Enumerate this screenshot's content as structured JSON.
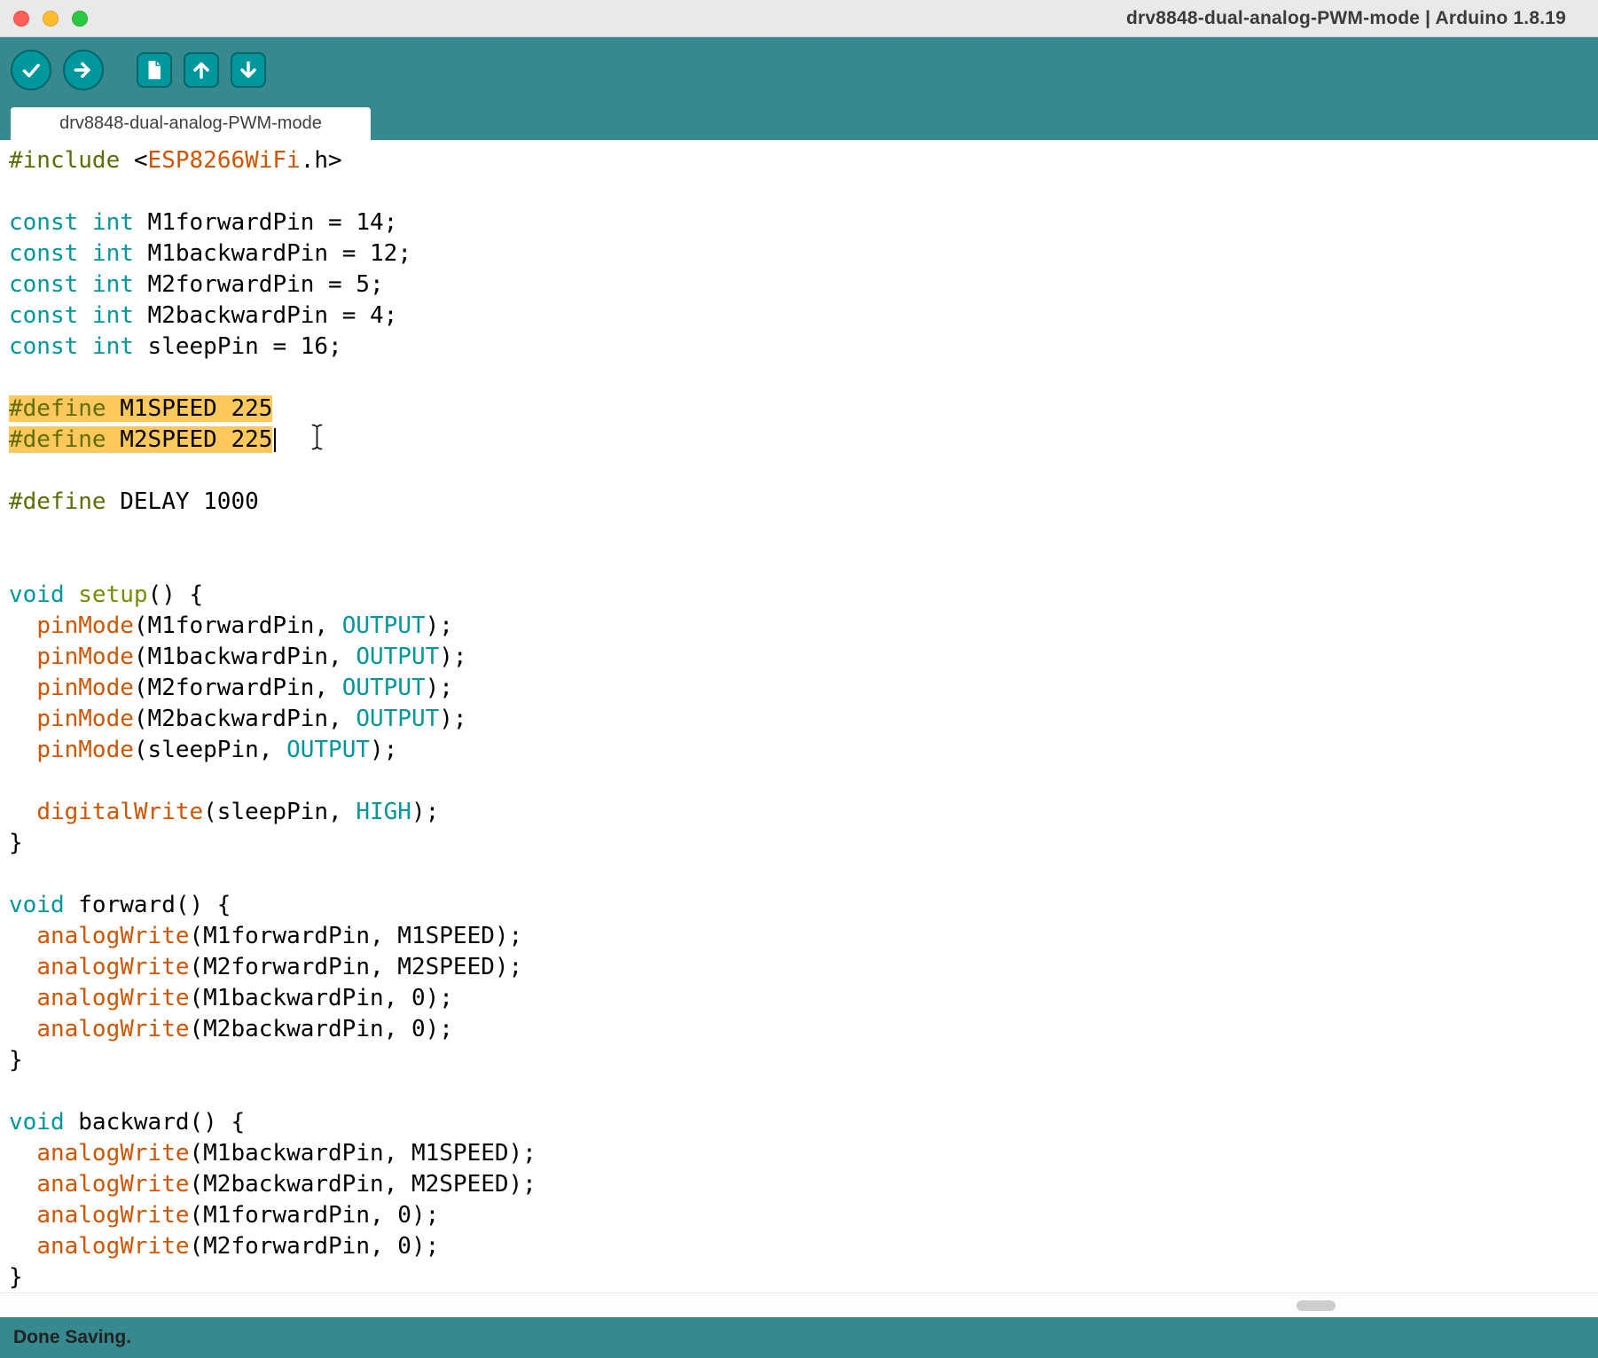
{
  "window": {
    "title": "drv8848-dual-analog-PWM-mode | Arduino 1.8.19"
  },
  "toolbar": {
    "buttons": [
      {
        "name": "verify",
        "icon": "check-icon",
        "shape": "circle"
      },
      {
        "name": "upload",
        "icon": "arrow-right-icon",
        "shape": "circle"
      },
      {
        "name": "new",
        "icon": "document-icon",
        "shape": "square"
      },
      {
        "name": "open",
        "icon": "arrow-up-icon",
        "shape": "square"
      },
      {
        "name": "save",
        "icon": "arrow-down-icon",
        "shape": "square"
      }
    ]
  },
  "tabs": [
    {
      "label": "drv8848-dual-analog-PWM-mode",
      "active": true
    }
  ],
  "status": {
    "message": "Done Saving."
  },
  "colors": {
    "titlebar_bg": "#E9E9E9",
    "bar_teal": "#35898F",
    "button_teal": "#00979D",
    "button_border": "#00666B",
    "keyword_teal": "#00979C",
    "function_orange": "#D35400",
    "setup_olive": "#728E00",
    "preprocessor_olive": "#5E6D03",
    "selection_yellow": "#FFC85C",
    "traffic_red": "#FF5F57",
    "traffic_yellow": "#FEBC2E",
    "traffic_green": "#28C840"
  },
  "editor": {
    "lines": [
      {
        "tokens": [
          [
            "pre",
            "#include "
          ],
          [
            "pl",
            "<"
          ],
          [
            "fn",
            "ESP8266WiFi"
          ],
          [
            "pl",
            ".h>"
          ]
        ]
      },
      {
        "tokens": []
      },
      {
        "tokens": [
          [
            "kw",
            "const"
          ],
          [
            "pl",
            " "
          ],
          [
            "kw",
            "int"
          ],
          [
            "pl",
            " M1forwardPin = 14;"
          ]
        ]
      },
      {
        "tokens": [
          [
            "kw",
            "const"
          ],
          [
            "pl",
            " "
          ],
          [
            "kw",
            "int"
          ],
          [
            "pl",
            " M1backwardPin = 12;"
          ]
        ]
      },
      {
        "tokens": [
          [
            "kw",
            "const"
          ],
          [
            "pl",
            " "
          ],
          [
            "kw",
            "int"
          ],
          [
            "pl",
            " M2forwardPin = 5;"
          ]
        ]
      },
      {
        "tokens": [
          [
            "kw",
            "const"
          ],
          [
            "pl",
            " "
          ],
          [
            "kw",
            "int"
          ],
          [
            "pl",
            " M2backwardPin = 4;"
          ]
        ]
      },
      {
        "tokens": [
          [
            "kw",
            "const"
          ],
          [
            "pl",
            " "
          ],
          [
            "kw",
            "int"
          ],
          [
            "pl",
            " sleepPin = 16;"
          ]
        ]
      },
      {
        "tokens": []
      },
      {
        "sel": true,
        "tokens": [
          [
            "pre",
            "#define "
          ],
          [
            "pl",
            "M1SPEED 225"
          ]
        ]
      },
      {
        "sel": true,
        "caret": true,
        "tokens": [
          [
            "pre",
            "#define "
          ],
          [
            "pl",
            "M2SPEED 225"
          ]
        ]
      },
      {
        "tokens": []
      },
      {
        "tokens": [
          [
            "pre",
            "#define "
          ],
          [
            "pl",
            "DELAY 1000"
          ]
        ]
      },
      {
        "tokens": []
      },
      {
        "tokens": []
      },
      {
        "tokens": [
          [
            "kw",
            "void"
          ],
          [
            "pl",
            " "
          ],
          [
            "fn2",
            "setup"
          ],
          [
            "pl",
            "() {"
          ]
        ]
      },
      {
        "tokens": [
          [
            "pl",
            "  "
          ],
          [
            "fn",
            "pinMode"
          ],
          [
            "pl",
            "(M1forwardPin, "
          ],
          [
            "kw",
            "OUTPUT"
          ],
          [
            "pl",
            ");"
          ]
        ]
      },
      {
        "tokens": [
          [
            "pl",
            "  "
          ],
          [
            "fn",
            "pinMode"
          ],
          [
            "pl",
            "(M1backwardPin, "
          ],
          [
            "kw",
            "OUTPUT"
          ],
          [
            "pl",
            ");"
          ]
        ]
      },
      {
        "tokens": [
          [
            "pl",
            "  "
          ],
          [
            "fn",
            "pinMode"
          ],
          [
            "pl",
            "(M2forwardPin, "
          ],
          [
            "kw",
            "OUTPUT"
          ],
          [
            "pl",
            ");"
          ]
        ]
      },
      {
        "tokens": [
          [
            "pl",
            "  "
          ],
          [
            "fn",
            "pinMode"
          ],
          [
            "pl",
            "(M2backwardPin, "
          ],
          [
            "kw",
            "OUTPUT"
          ],
          [
            "pl",
            ");"
          ]
        ]
      },
      {
        "tokens": [
          [
            "pl",
            "  "
          ],
          [
            "fn",
            "pinMode"
          ],
          [
            "pl",
            "(sleepPin, "
          ],
          [
            "kw",
            "OUTPUT"
          ],
          [
            "pl",
            ");"
          ]
        ]
      },
      {
        "tokens": []
      },
      {
        "tokens": [
          [
            "pl",
            "  "
          ],
          [
            "fn",
            "digitalWrite"
          ],
          [
            "pl",
            "(sleepPin, "
          ],
          [
            "kw",
            "HIGH"
          ],
          [
            "pl",
            ");"
          ]
        ]
      },
      {
        "tokens": [
          [
            "pl",
            "}"
          ]
        ]
      },
      {
        "tokens": []
      },
      {
        "tokens": [
          [
            "kw",
            "void"
          ],
          [
            "pl",
            " forward() {"
          ]
        ]
      },
      {
        "tokens": [
          [
            "pl",
            "  "
          ],
          [
            "fn",
            "analogWrite"
          ],
          [
            "pl",
            "(M1forwardPin, M1SPEED);"
          ]
        ]
      },
      {
        "tokens": [
          [
            "pl",
            "  "
          ],
          [
            "fn",
            "analogWrite"
          ],
          [
            "pl",
            "(M2forwardPin, M2SPEED);"
          ]
        ]
      },
      {
        "tokens": [
          [
            "pl",
            "  "
          ],
          [
            "fn",
            "analogWrite"
          ],
          [
            "pl",
            "(M1backwardPin, 0);"
          ]
        ]
      },
      {
        "tokens": [
          [
            "pl",
            "  "
          ],
          [
            "fn",
            "analogWrite"
          ],
          [
            "pl",
            "(M2backwardPin, 0);"
          ]
        ]
      },
      {
        "tokens": [
          [
            "pl",
            "}"
          ]
        ]
      },
      {
        "tokens": []
      },
      {
        "tokens": [
          [
            "kw",
            "void"
          ],
          [
            "pl",
            " backward() {"
          ]
        ]
      },
      {
        "tokens": [
          [
            "pl",
            "  "
          ],
          [
            "fn",
            "analogWrite"
          ],
          [
            "pl",
            "(M1backwardPin, M1SPEED);"
          ]
        ]
      },
      {
        "tokens": [
          [
            "pl",
            "  "
          ],
          [
            "fn",
            "analogWrite"
          ],
          [
            "pl",
            "(M2backwardPin, M2SPEED);"
          ]
        ]
      },
      {
        "tokens": [
          [
            "pl",
            "  "
          ],
          [
            "fn",
            "analogWrite"
          ],
          [
            "pl",
            "(M1forwardPin, 0);"
          ]
        ]
      },
      {
        "tokens": [
          [
            "pl",
            "  "
          ],
          [
            "fn",
            "analogWrite"
          ],
          [
            "pl",
            "(M2forwardPin, 0);"
          ]
        ]
      },
      {
        "tokens": [
          [
            "pl",
            "}"
          ]
        ]
      }
    ]
  }
}
